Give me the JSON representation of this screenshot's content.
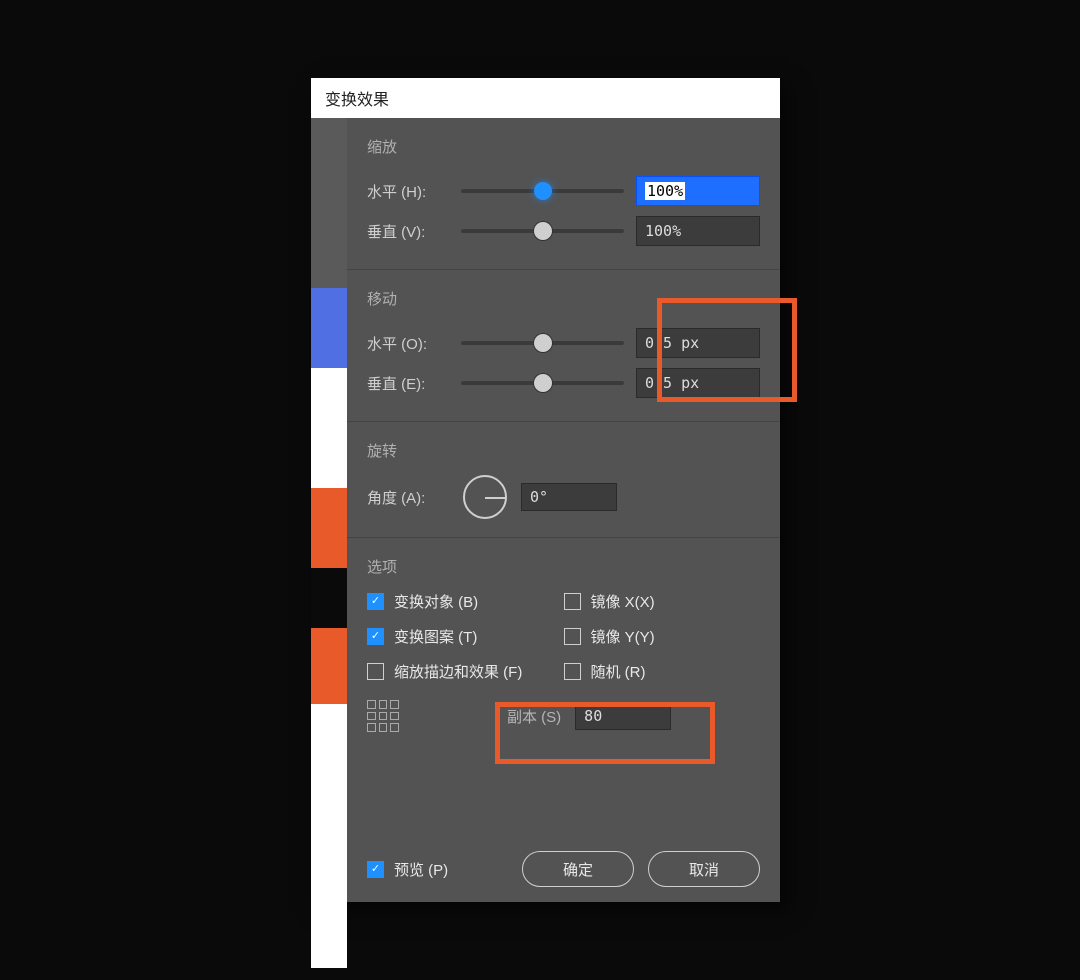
{
  "dialog": {
    "title": "变换效果",
    "scale": {
      "section": "缩放",
      "h_label": "水平 (H):",
      "h_value": "100%",
      "v_label": "垂直 (V):",
      "v_value": "100%"
    },
    "move": {
      "section": "移动",
      "h_label": "水平 (O):",
      "h_value": "0.5 px",
      "v_label": "垂直 (E):",
      "v_value": "0.5 px"
    },
    "rotate": {
      "section": "旋转",
      "a_label": "角度 (A):",
      "a_value": "0°"
    },
    "options": {
      "section": "选项",
      "transform_objects": "变换对象 (B)",
      "transform_patterns": "变换图案 (T)",
      "scale_strokes": "缩放描边和效果 (F)",
      "mirror_x": "镜像 X(X)",
      "mirror_y": "镜像 Y(Y)",
      "random": "随机 (R)",
      "copies_label": "副本 (S)",
      "copies_value": "80"
    },
    "footer": {
      "preview": "预览 (P)",
      "ok": "确定",
      "cancel": "取消"
    }
  }
}
